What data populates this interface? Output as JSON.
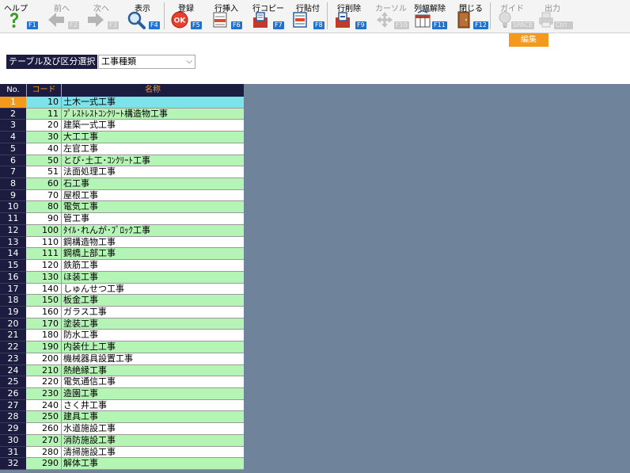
{
  "toolbar": {
    "buttons": [
      {
        "label": "ヘルプ",
        "key": "F1",
        "icon": "help-icon",
        "disabled": false
      },
      {
        "label": "前へ",
        "key": "F2",
        "icon": "arrow-left-icon",
        "disabled": true
      },
      {
        "label": "次へ",
        "key": "F3",
        "icon": "arrow-right-icon",
        "disabled": true
      },
      {
        "label": "表示",
        "key": "F4",
        "icon": "search-icon",
        "disabled": false
      },
      {
        "label": "登録",
        "key": "F5",
        "icon": "ok-icon",
        "disabled": false
      },
      {
        "label": "行挿入",
        "key": "F6",
        "icon": "row-insert-icon",
        "disabled": false
      },
      {
        "label": "行コピー",
        "key": "F7",
        "icon": "row-copy-icon",
        "disabled": false
      },
      {
        "label": "行貼付",
        "key": "F8",
        "icon": "row-paste-icon",
        "disabled": false
      },
      {
        "label": "行削除",
        "key": "F9",
        "icon": "row-delete-icon",
        "disabled": false
      },
      {
        "label": "カーソル",
        "key": "F10",
        "icon": "cursor-icon",
        "disabled": true
      },
      {
        "label": "列幅解除",
        "key": "F11",
        "icon": "column-width-icon",
        "disabled": false
      },
      {
        "label": "閉じる",
        "key": "F12",
        "icon": "close-door-icon",
        "disabled": false
      },
      {
        "label": "ガイド",
        "key": "SPACE",
        "icon": "guide-bulb-icon",
        "disabled": true
      },
      {
        "label": "出力",
        "key": "Ctrl P",
        "icon": "output-icon",
        "disabled": true
      }
    ],
    "edit_label": "編集"
  },
  "selector": {
    "label": "テーブル及び区分選択",
    "value": "工事種類"
  },
  "grid": {
    "columns": {
      "no": "No.",
      "code": "コード",
      "name": "名称"
    },
    "rows": [
      {
        "no": "1",
        "code": "10",
        "name": "土木一式工事"
      },
      {
        "no": "2",
        "code": "11",
        "name": "ﾌﾟﾚｽﾄﾚｽﾄｺﾝｸﾘｰﾄ構造物工事"
      },
      {
        "no": "3",
        "code": "20",
        "name": "建築一式工事"
      },
      {
        "no": "4",
        "code": "30",
        "name": "大工工事"
      },
      {
        "no": "5",
        "code": "40",
        "name": "左官工事"
      },
      {
        "no": "6",
        "code": "50",
        "name": "とび･土工･ｺﾝｸﾘｰﾄ工事"
      },
      {
        "no": "7",
        "code": "51",
        "name": "法面処理工事"
      },
      {
        "no": "8",
        "code": "60",
        "name": "石工事"
      },
      {
        "no": "9",
        "code": "70",
        "name": "屋根工事"
      },
      {
        "no": "10",
        "code": "80",
        "name": "電気工事"
      },
      {
        "no": "11",
        "code": "90",
        "name": "管工事"
      },
      {
        "no": "12",
        "code": "100",
        "name": "ﾀｲﾙ･れんが･ﾌﾞﾛｯｸ工事"
      },
      {
        "no": "13",
        "code": "110",
        "name": "鋼構造物工事"
      },
      {
        "no": "14",
        "code": "111",
        "name": "鋼橋上部工事"
      },
      {
        "no": "15",
        "code": "120",
        "name": "鉄筋工事"
      },
      {
        "no": "16",
        "code": "130",
        "name": "ほ装工事"
      },
      {
        "no": "17",
        "code": "140",
        "name": "しゅんせつ工事"
      },
      {
        "no": "18",
        "code": "150",
        "name": "板金工事"
      },
      {
        "no": "19",
        "code": "160",
        "name": "ガラス工事"
      },
      {
        "no": "20",
        "code": "170",
        "name": "塗装工事"
      },
      {
        "no": "21",
        "code": "180",
        "name": "防水工事"
      },
      {
        "no": "22",
        "code": "190",
        "name": "内装仕上工事"
      },
      {
        "no": "23",
        "code": "200",
        "name": "機械器具設置工事"
      },
      {
        "no": "24",
        "code": "210",
        "name": "熱絶縁工事"
      },
      {
        "no": "25",
        "code": "220",
        "name": "電気通信工事"
      },
      {
        "no": "26",
        "code": "230",
        "name": "造園工事"
      },
      {
        "no": "27",
        "code": "240",
        "name": "さく井工事"
      },
      {
        "no": "28",
        "code": "250",
        "name": "建具工事"
      },
      {
        "no": "29",
        "code": "260",
        "name": "水道施設工事"
      },
      {
        "no": "30",
        "code": "270",
        "name": "消防施設工事"
      },
      {
        "no": "31",
        "code": "280",
        "name": "清掃施設工事"
      },
      {
        "no": "32",
        "code": "290",
        "name": "解体工事"
      }
    ]
  },
  "colors": {
    "header_bg": "#1c1c40",
    "accent": "#f39a1c",
    "row_even": "#b4f4b4",
    "row_selected": "#7be3e9",
    "background": "#6f849a",
    "fkey": "#1e73d2"
  }
}
